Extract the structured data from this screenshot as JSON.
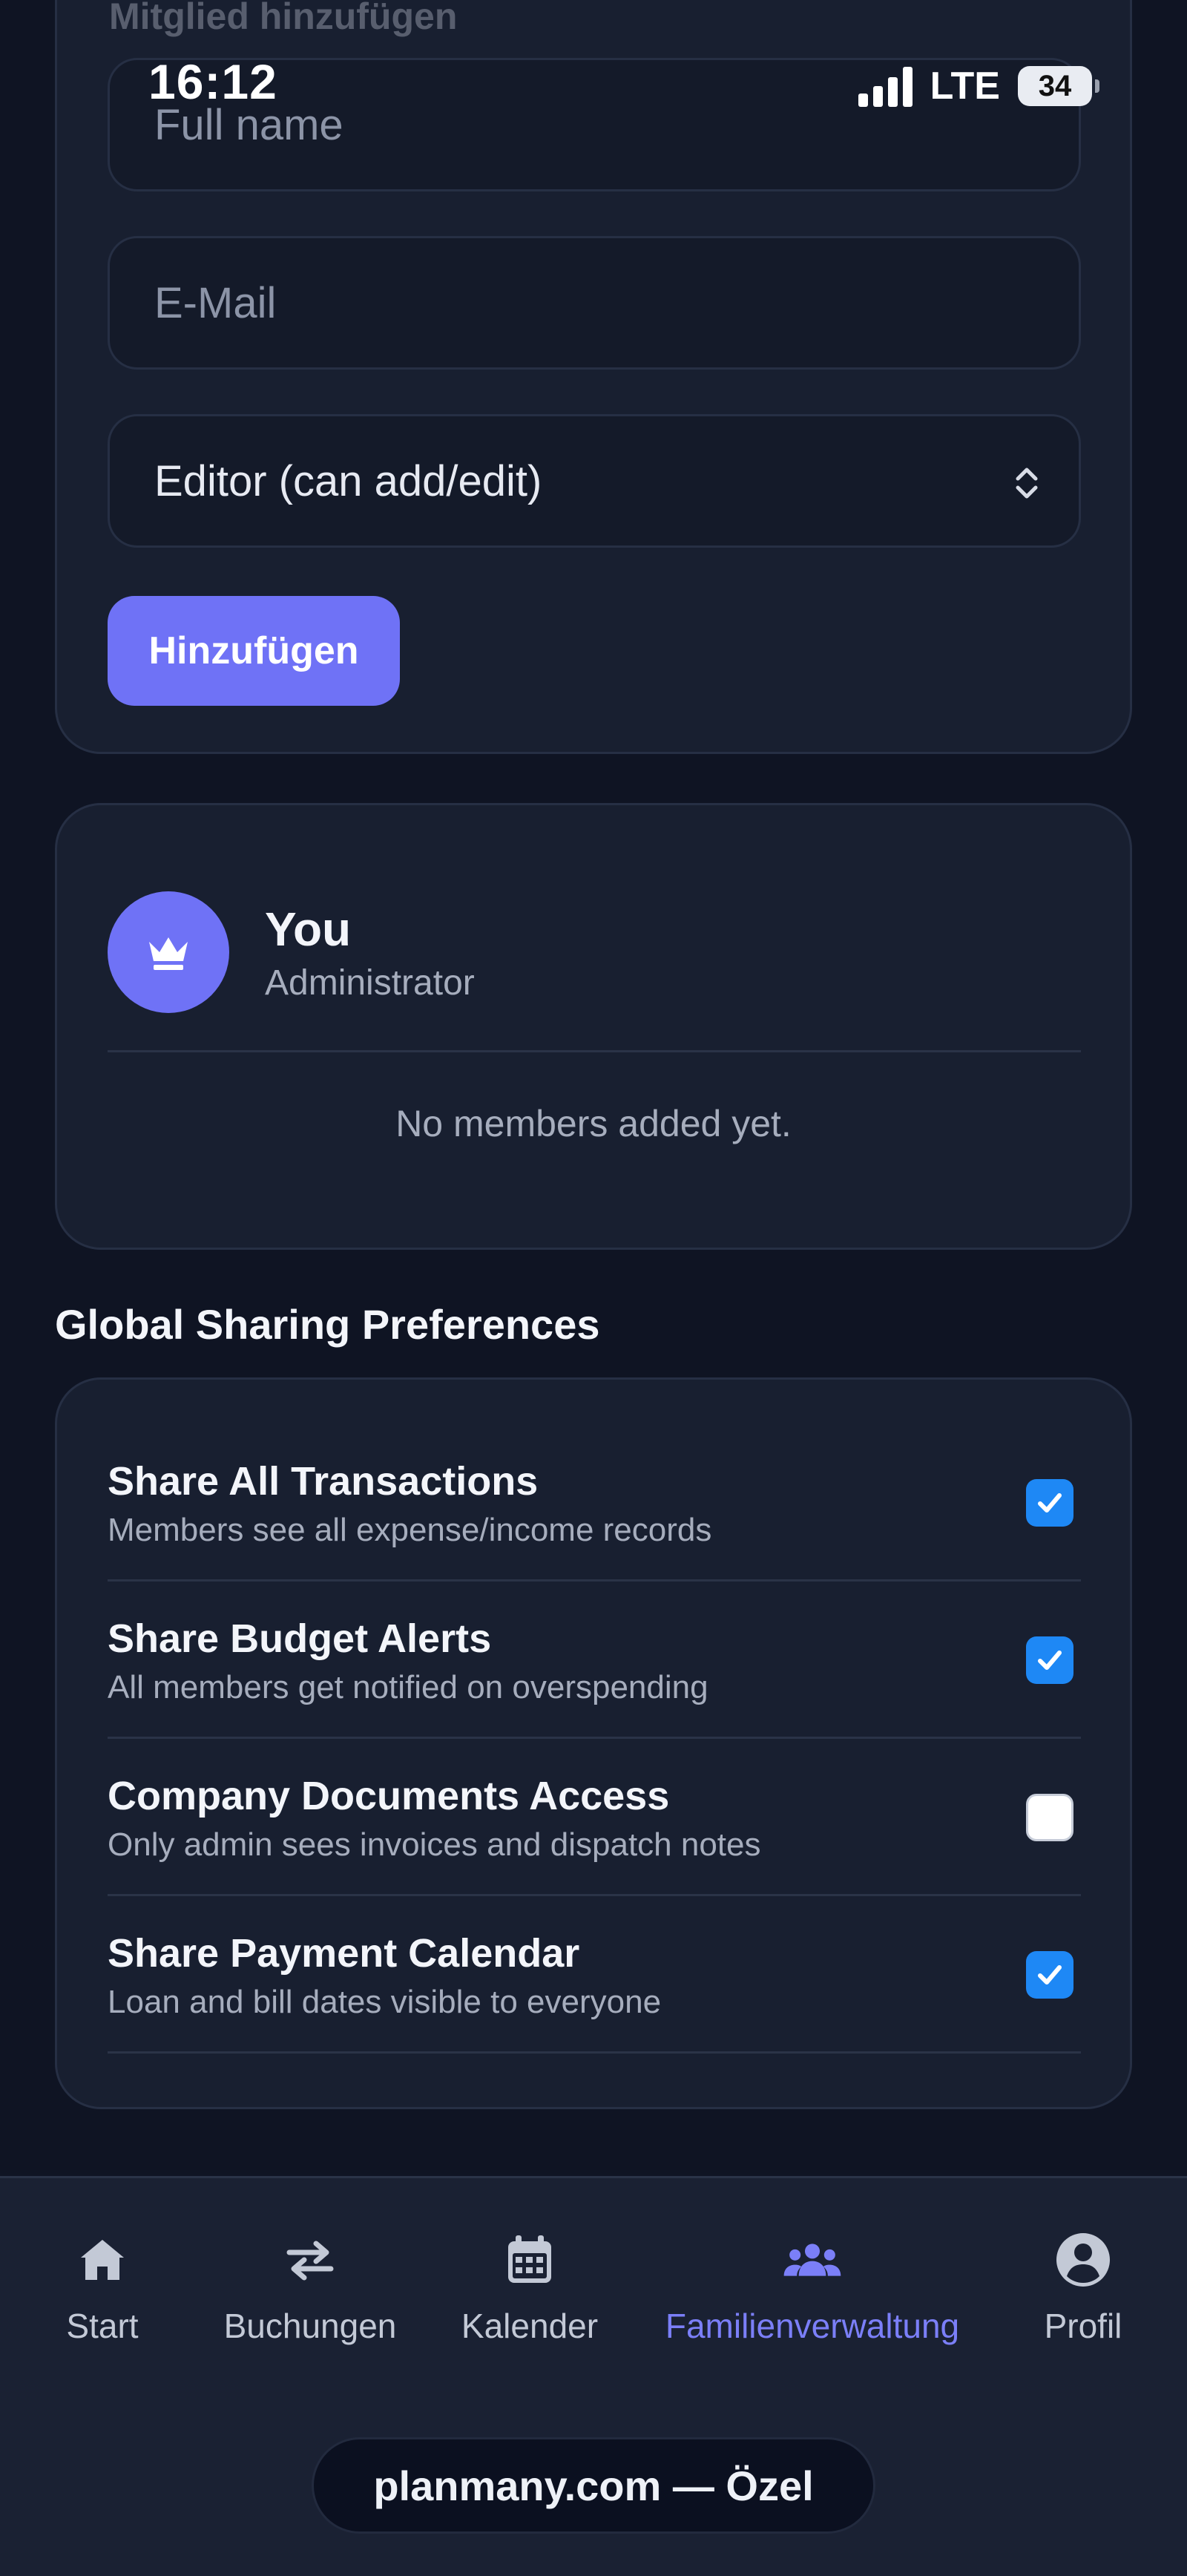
{
  "status_bar": {
    "time": "16:12",
    "network": "LTE",
    "battery": "34"
  },
  "add_member": {
    "title": "Mitglied hinzufügen",
    "name_placeholder": "Full name",
    "email_placeholder": "E-Mail",
    "role_selected": "Editor (can add/edit)",
    "add_button": "Hinzufügen"
  },
  "members": {
    "self_name": "You",
    "self_role": "Administrator",
    "empty_text": "No members added yet."
  },
  "sharing": {
    "section_title": "Global Sharing Preferences",
    "preferences": [
      {
        "title": "Share All Transactions",
        "description": "Members see all expense/income records",
        "checked": true
      },
      {
        "title": "Share Budget Alerts",
        "description": "All members get notified on overspending",
        "checked": true
      },
      {
        "title": "Company Documents Access",
        "description": "Only admin sees invoices and dispatch notes",
        "checked": false
      },
      {
        "title": "Share Payment Calendar",
        "description": "Loan and bill dates visible to everyone",
        "checked": true
      }
    ]
  },
  "bottom_nav": {
    "items": [
      {
        "label": "Start",
        "icon": "home-icon"
      },
      {
        "label": "Buchungen",
        "icon": "transfer-arrows-icon"
      },
      {
        "label": "Kalender",
        "icon": "calendar-icon"
      },
      {
        "label": "Familienverwaltung",
        "icon": "group-icon",
        "active": true
      },
      {
        "label": "Profil",
        "icon": "account-circle-icon"
      }
    ]
  },
  "url_pill": "planmany.com — Özel",
  "colors": {
    "background": "#0f1423",
    "card": "#181f30",
    "accent": "#6f72f6",
    "checkbox_on": "#1e88f5",
    "nav_active": "#7b7ff8"
  }
}
